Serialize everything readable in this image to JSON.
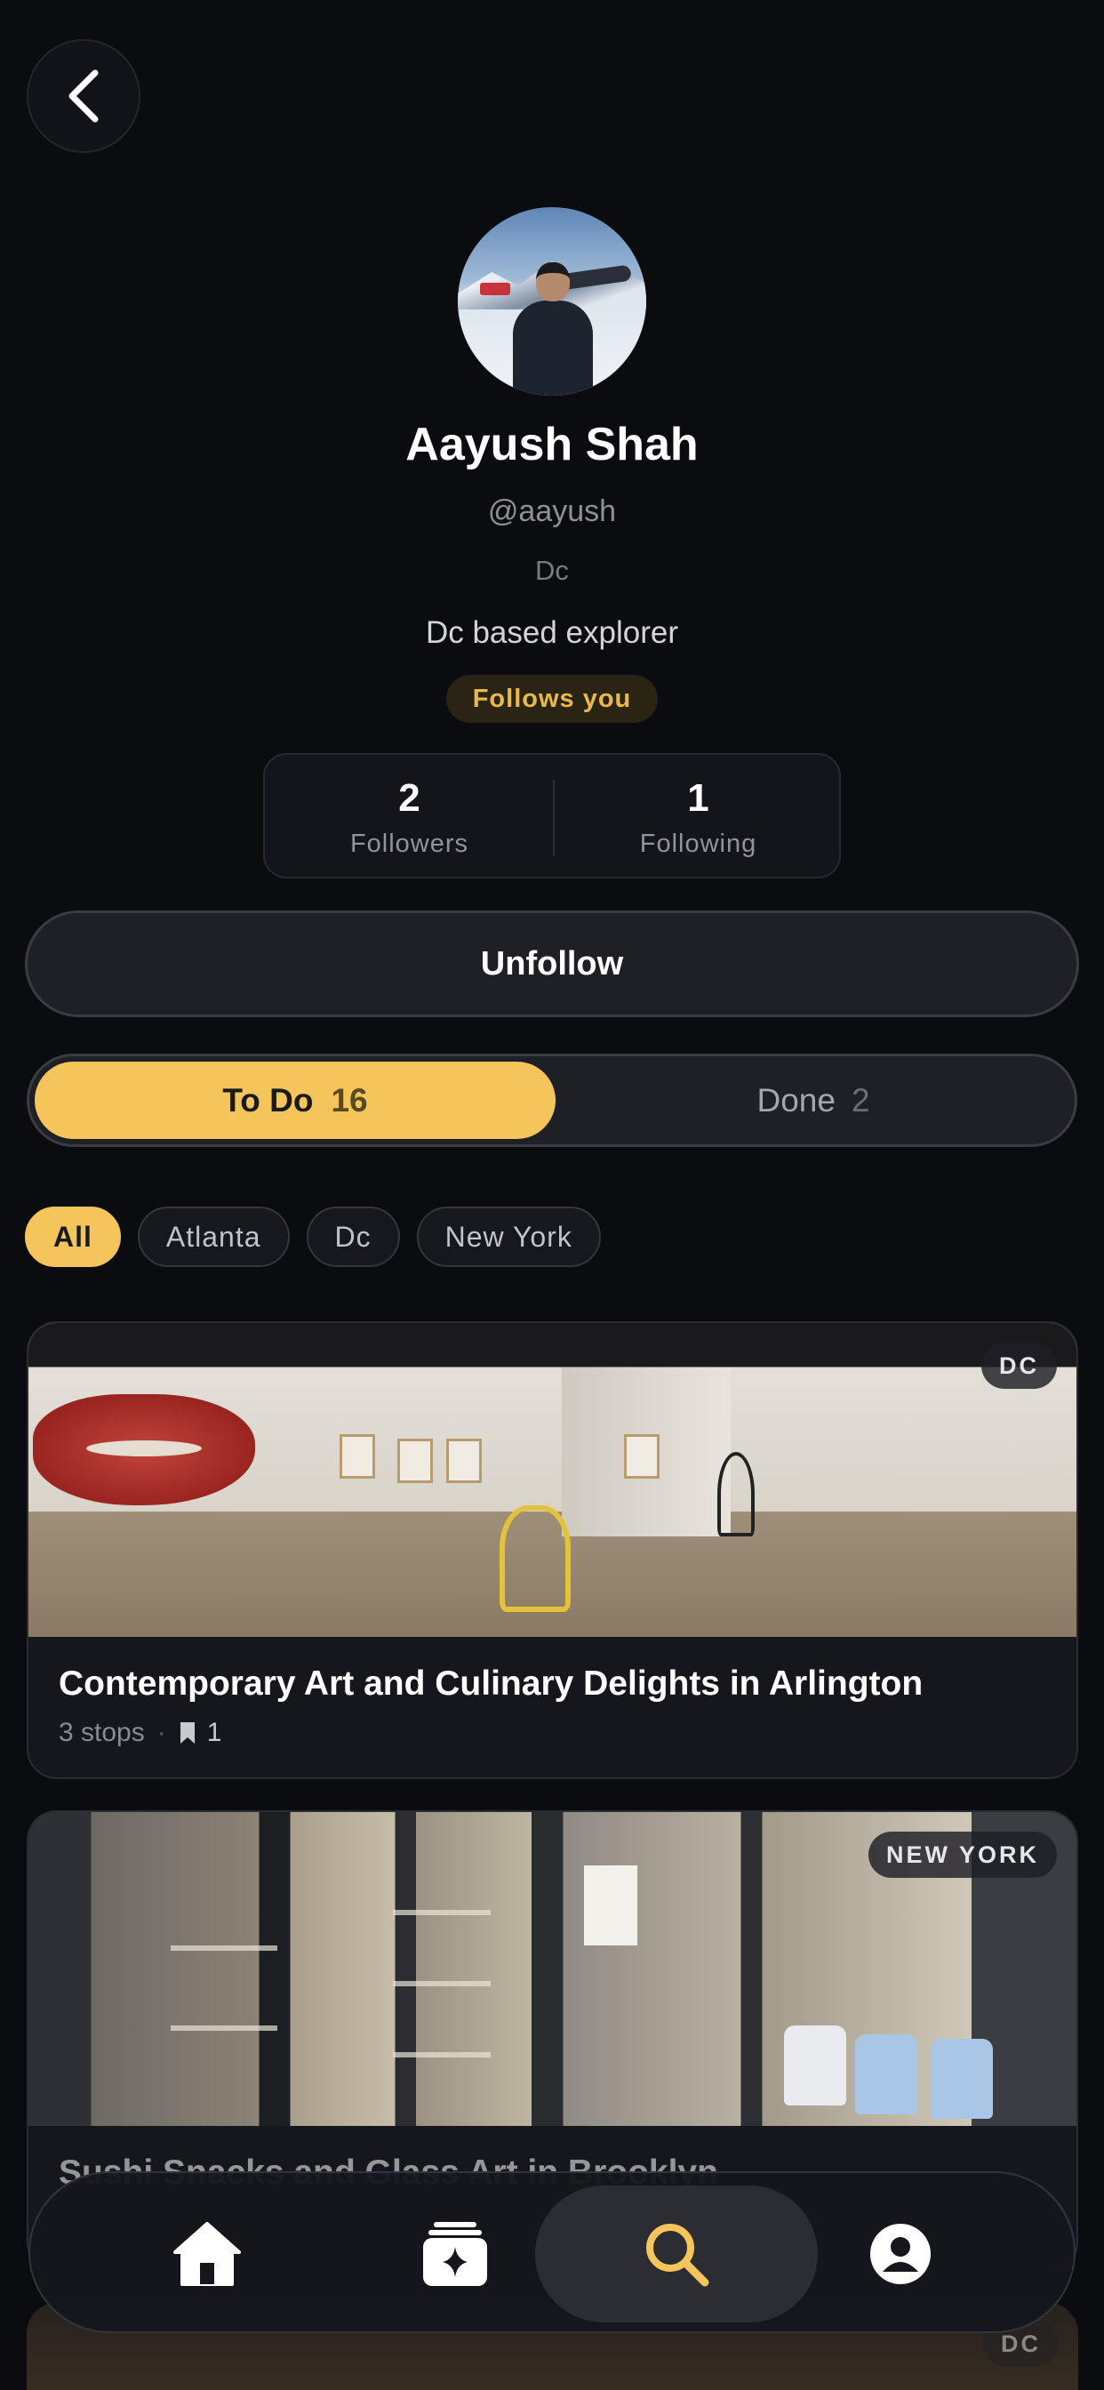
{
  "profile": {
    "name": "Aayush Shah",
    "handle": "@aayush",
    "location": "Dc",
    "bio": "Dc based explorer",
    "follows_badge": "Follows you"
  },
  "stats": {
    "followers": {
      "value": "2",
      "label": "Followers"
    },
    "following": {
      "value": "1",
      "label": "Following"
    }
  },
  "actions": {
    "unfollow_label": "Unfollow"
  },
  "segmented": {
    "todo": {
      "label": "To Do",
      "count": "16",
      "selected": true
    },
    "done": {
      "label": "Done",
      "count": "2"
    }
  },
  "filters": {
    "chips": [
      {
        "label": "All",
        "active": true
      },
      {
        "label": "Atlanta"
      },
      {
        "label": "Dc"
      },
      {
        "label": "New York"
      }
    ]
  },
  "itineraries": [
    {
      "city_badge": "DC",
      "title": "Contemporary Art and Culinary Delights in Arlington",
      "stops": "3 stops",
      "bookmarks": "1"
    },
    {
      "city_badge": "NEW YORK",
      "title": "Sushi Snacks and Glass Art in Brooklyn",
      "stops": "",
      "bookmarks": ""
    },
    {
      "city_badge": "DC"
    }
  ],
  "nav": {
    "items": [
      {
        "icon": "home-icon"
      },
      {
        "icon": "sparkle-cards-icon"
      },
      {
        "icon": "search-icon",
        "active": true
      },
      {
        "icon": "profile-icon"
      }
    ]
  },
  "colors": {
    "background": "#0b0c10",
    "accent": "#f5c55b",
    "badge_text": "#e9b94a"
  }
}
